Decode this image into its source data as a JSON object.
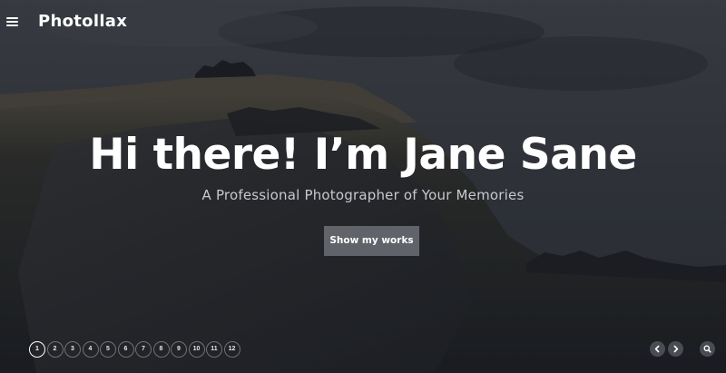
{
  "header": {
    "brand": "Photollax"
  },
  "hero": {
    "title": "Hi there! I’m Jane Sane",
    "subtitle": "A Professional Photographer of Your Memories",
    "cta_label": "Show my works"
  },
  "pagination": {
    "pages": [
      "1",
      "2",
      "3",
      "4",
      "5",
      "6",
      "7",
      "8",
      "9",
      "10",
      "11",
      "12"
    ],
    "active": "1"
  },
  "controls": {
    "prev_icon": "chevron-left-icon",
    "next_icon": "chevron-right-icon",
    "search_icon": "search-icon"
  }
}
